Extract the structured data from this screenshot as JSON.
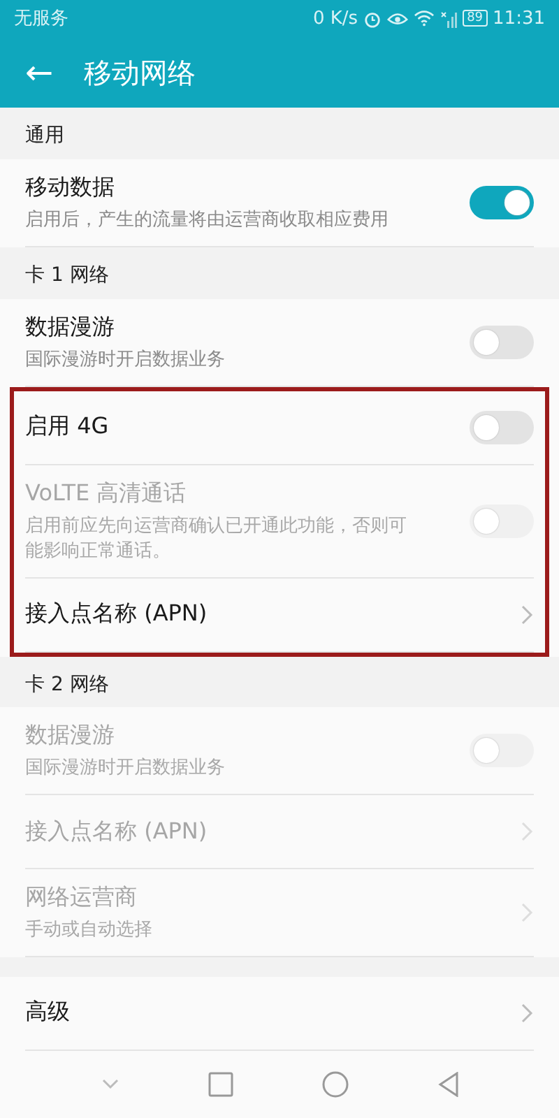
{
  "status_bar": {
    "carrier": "无服务",
    "speed": "0 K/s",
    "battery": "89",
    "time": "11:31"
  },
  "app_bar": {
    "back": "←",
    "title": "移动网络"
  },
  "sections": [
    {
      "header": "通用",
      "rows": [
        {
          "kind": "switch",
          "title": "移动数据",
          "subtitle": "启用后，产生的流量将由运营商收取相应费用",
          "on": true,
          "disabled": false,
          "highlighted": false
        }
      ]
    },
    {
      "header": "卡 1 网络",
      "rows": [
        {
          "kind": "switch",
          "title": "数据漫游",
          "subtitle": "国际漫游时开启数据业务",
          "on": false,
          "disabled": false,
          "highlighted": false
        },
        {
          "kind": "switch",
          "title": "启用 4G",
          "on": false,
          "disabled": false,
          "highlighted": true
        },
        {
          "kind": "switch",
          "title": "VoLTE 高清通话",
          "subtitle": "启用前应先向运营商确认已开通此功能，否则可能影响正常通话。",
          "on": false,
          "disabled": true,
          "highlighted": true
        },
        {
          "kind": "link",
          "title": "接入点名称 (APN)",
          "disabled": false,
          "highlighted": true
        }
      ]
    },
    {
      "header": "卡 2 网络",
      "rows": [
        {
          "kind": "switch",
          "title": "数据漫游",
          "subtitle": "国际漫游时开启数据业务",
          "on": false,
          "disabled": true,
          "highlighted": false
        },
        {
          "kind": "link",
          "title": "接入点名称 (APN)",
          "disabled": true,
          "highlighted": false
        },
        {
          "kind": "link",
          "title": "网络运营商",
          "subtitle": "手动或自动选择",
          "disabled": true,
          "highlighted": false
        }
      ]
    },
    {
      "rows": [
        {
          "kind": "link",
          "title": "高级",
          "disabled": false,
          "highlighted": false
        }
      ]
    }
  ]
}
